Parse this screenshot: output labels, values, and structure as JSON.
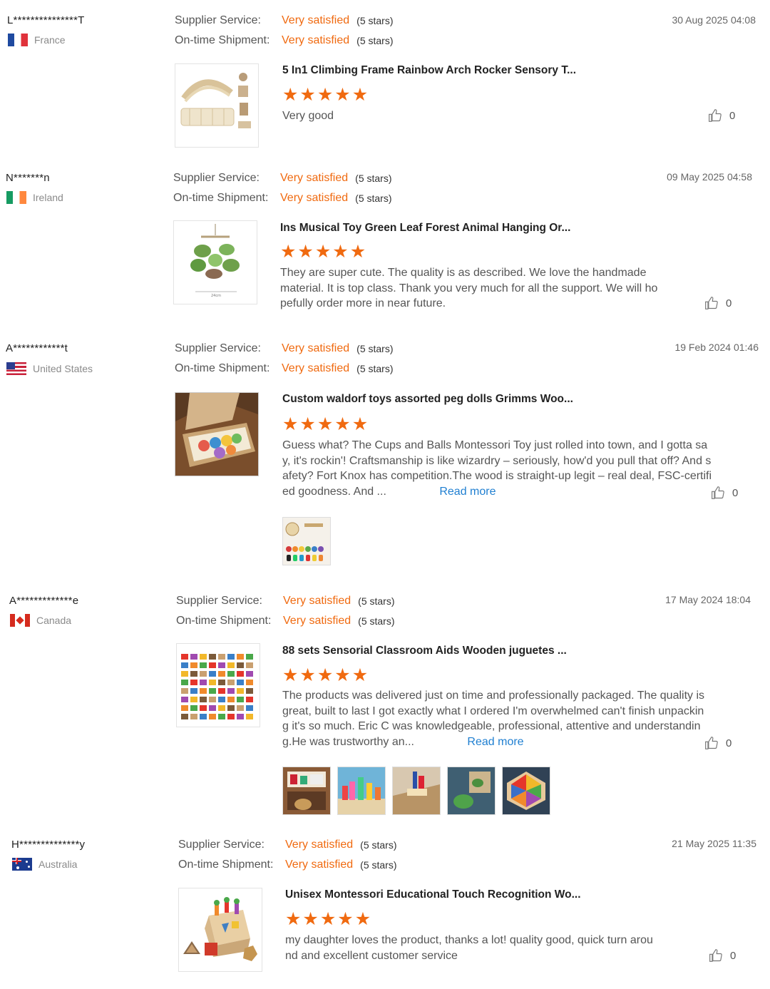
{
  "labels": {
    "supplier_service": "Supplier Service:",
    "ontime_shipment": "On-time Shipment:",
    "read_more": "Read more",
    "accent_color": "#f06a10",
    "link_color": "#1f7fd1"
  },
  "reviews": [
    {
      "user": "L***************T",
      "country": "France",
      "supplier_value": "Very satisfied",
      "supplier_stars": "(5 stars)",
      "shipment_value": "Very satisfied",
      "shipment_stars": "(5 stars)",
      "date": "30 Aug 2025 04:08",
      "product_title": "5 In1 Climbing Frame Rainbow Arch Rocker Sensory T...",
      "rating": 5,
      "text": "Very good",
      "likes": "0"
    },
    {
      "user": "N*******n",
      "country": "Ireland",
      "supplier_value": "Very satisfied",
      "supplier_stars": "(5 stars)",
      "shipment_value": "Very satisfied",
      "shipment_stars": "(5 stars)",
      "date": "09 May 2025 04:58",
      "product_title": "Ins Musical Toy Green Leaf Forest Animal Hanging Or...",
      "rating": 5,
      "text": "They are super cute. The quality is as described. We love the handmade material. It is top class. Thank you very much for all the support. We will hopefully order more in near future.",
      "likes": "0"
    },
    {
      "user": "A************t",
      "country": "United States",
      "supplier_value": "Very satisfied",
      "supplier_stars": "(5 stars)",
      "shipment_value": "Very satisfied",
      "shipment_stars": "(5 stars)",
      "date": "19 Feb 2024 01:46",
      "product_title": "Custom waldorf toys assorted peg dolls Grimms Woo...",
      "rating": 5,
      "text": "Guess what? The Cups and Balls Montessori Toy just rolled into town, and I gotta say, it's rockin'! Craftsmanship is like wizardry – seriously, how'd you pull that off? And safety? Fort Knox has competition.The wood is straight-up legit – real deal, FSC-certified goodness. And ...",
      "likes": "0"
    },
    {
      "user": "A*************e",
      "country": "Canada",
      "supplier_value": "Very satisfied",
      "supplier_stars": "(5 stars)",
      "shipment_value": "Very satisfied",
      "shipment_stars": "(5 stars)",
      "date": "17 May 2024 18:04",
      "product_title": "88 sets Sensorial Classroom Aids Wooden juguetes ...",
      "rating": 5,
      "text": "The products was delivered just on time and professionally packaged. The quality is great, built to last I got exactly what I ordered I'm overwhelmed can't finish unpacking it's so much. Eric C  was knowledgeable, professional, attentive and understanding.He was trustworthy an...",
      "likes": "0"
    },
    {
      "user": "H**************y",
      "country": "Australia",
      "supplier_value": "Very satisfied",
      "supplier_stars": "(5 stars)",
      "shipment_value": "Very satisfied",
      "shipment_stars": "(5 stars)",
      "date": "21 May 2025 11:35",
      "product_title": "Unisex Montessori Educational Touch Recognition Wo...",
      "rating": 5,
      "text": "my daughter loves the product, thanks a lot! quality good, quick turn around and excellent customer service",
      "likes": "0"
    }
  ]
}
